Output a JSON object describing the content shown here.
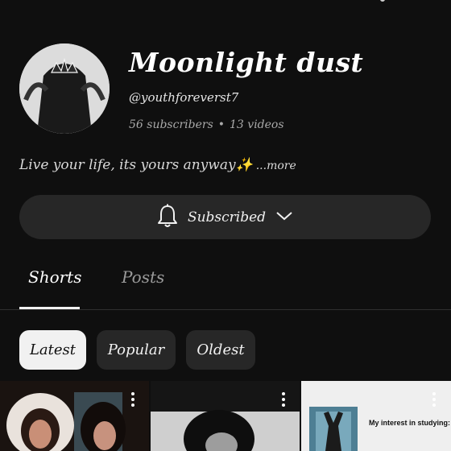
{
  "channel": {
    "name": "Moonlight dust",
    "handle": "@youthforeverst7",
    "subscribers": "56 subscribers",
    "separator": "•",
    "videos": "13 videos",
    "bio": "Live your life, its yours anyway✨",
    "more_label": "...more"
  },
  "subscribe_button": {
    "label": "Subscribed",
    "icon": "bell-icon",
    "dropdown_icon": "chevron-down-icon"
  },
  "tabs": [
    {
      "label": "Shorts",
      "active": true
    },
    {
      "label": "Posts",
      "active": false
    }
  ],
  "filters": [
    {
      "label": "Latest",
      "selected": true
    },
    {
      "label": "Popular",
      "selected": false
    },
    {
      "label": "Oldest",
      "selected": false
    }
  ],
  "shorts": [
    {
      "caption": ""
    },
    {
      "caption": ""
    },
    {
      "caption": "My interest in studying:"
    }
  ],
  "colors": {
    "background": "#0f0f0f",
    "button_bg": "#272727",
    "chip_selected_bg": "#f1f1f1",
    "text": "#f1f1f1",
    "muted": "#a9a9a9"
  }
}
